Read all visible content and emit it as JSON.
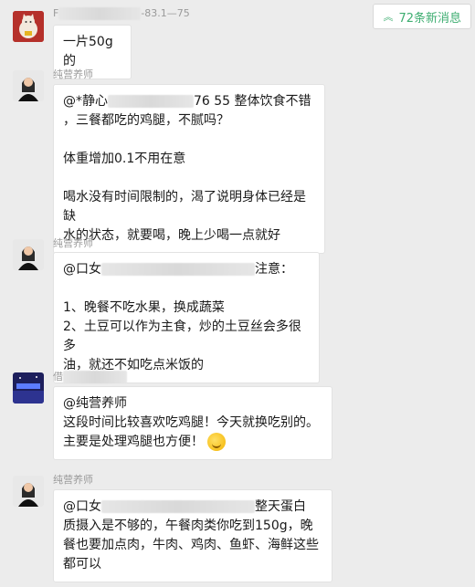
{
  "new_messages": {
    "label": "72条新消息",
    "icon": "double-chevron-up-icon"
  },
  "messages": [
    {
      "sender": "F",
      "sender_suffix": "-83.1—75",
      "text": "一片50g的"
    },
    {
      "sender": "纯营养师",
      "mention": "@*静心",
      "mention_suffix": "76 55 整体饮食不错",
      "lines": [
        "，三餐都吃的鸡腿，不腻吗？",
        "体重增加0.1不用在意",
        "喝水没有时间限制的，渴了说明身体已经是缺",
        "水的状态，就要喝，晚上少喝一点就好"
      ]
    },
    {
      "sender": "纯营养师",
      "mention": "@口女",
      "mention_suffix": "注意：",
      "lines": [
        "1、晚餐不吃水果，换成蔬菜",
        "2、土豆可以作为主食，炒的土豆丝会多很多",
        "油，就还不如吃点米饭的"
      ]
    },
    {
      "sender": "借",
      "mention": "@纯营养师",
      "lines": [
        "这段时间比较喜欢吃鸡腿！今天就换吃别的。",
        "主要是处理鸡腿也方便！"
      ],
      "emoji": "laughing-tears-emoji-icon"
    },
    {
      "sender": "纯营养师",
      "mention": "@口女",
      "mention_suffix": "整天蛋白",
      "lines": [
        "质摄入是不够的，午餐肉类你吃到150g，晚",
        "餐也要加点肉，牛肉、鸡肉、鱼虾、海鲜这些",
        "都可以"
      ]
    }
  ]
}
